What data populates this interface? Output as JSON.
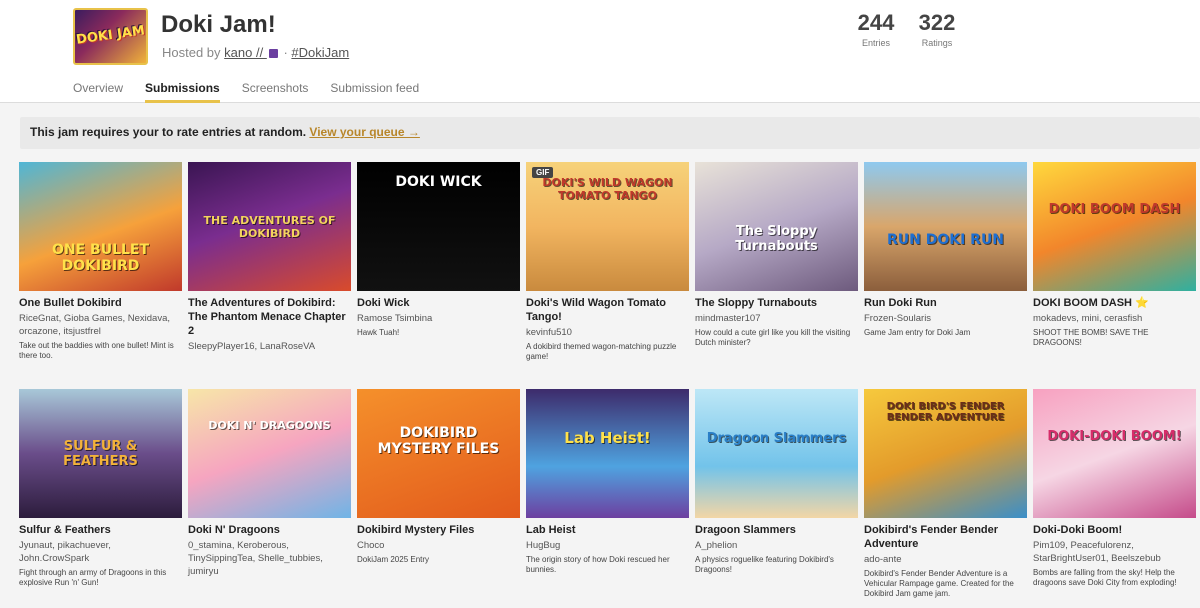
{
  "jam": {
    "title": "Doki Jam!",
    "logo_text": "DOKI JAM",
    "hosted_prefix": "Hosted by",
    "host": "kano // ",
    "host_icon": "floppy-disk-icon",
    "hashtag": "#DokiJam",
    "stats": [
      {
        "value": "244",
        "label": "Entries"
      },
      {
        "value": "322",
        "label": "Ratings"
      }
    ]
  },
  "tabs": [
    {
      "label": "Overview",
      "active": false
    },
    {
      "label": "Submissions",
      "active": true
    },
    {
      "label": "Screenshots",
      "active": false
    },
    {
      "label": "Submission feed",
      "active": false
    }
  ],
  "notice": {
    "text": "This jam requires your to rate entries at random.",
    "link": "View your queue →"
  },
  "games": [
    {
      "title": "One Bullet Dokibird",
      "authors": "RiceGnat, Gioba Games, Nexidava, orcazone, itsjustfrel",
      "desc": "Take out the baddies with one bullet! Mint is there too.",
      "cover_text": "ONE BULLET DOKIBIRD",
      "gif": false
    },
    {
      "title": "The Adventures of Dokibird: The Phantom Menace Chapter 2",
      "authors": "SleepyPlayer16, LanaRoseVA",
      "desc": "",
      "cover_text": "THE ADVENTURES OF DOKIBIRD",
      "gif": false
    },
    {
      "title": "Doki Wick",
      "authors": "Ramose Tsimbina",
      "desc": "Hawk Tuah!",
      "cover_text": "DOKI WICK",
      "gif": false
    },
    {
      "title": "Doki's Wild Wagon Tomato Tango!",
      "authors": "kevinfu510",
      "desc": "A dokibird themed wagon-matching puzzle game!",
      "cover_text": "DOKI'S WILD WAGON TOMATO TANGO",
      "gif": true,
      "gif_label": "GIF"
    },
    {
      "title": "The Sloppy Turnabouts",
      "authors": "mindmaster107",
      "desc": "How could a cute girl like you kill the visiting Dutch minister?",
      "cover_text": "The Sloppy Turnabouts",
      "gif": false
    },
    {
      "title": "Run Doki Run",
      "authors": "Frozen-Soularis",
      "desc": "Game Jam entry for Doki Jam",
      "cover_text": "RUN DOKI RUN",
      "gif": false
    },
    {
      "title": "DOKI BOOM DASH ⭐",
      "authors": "mokadevs, mini, cerasfish",
      "desc": "SHOOT THE BOMB! SAVE THE DRAGOONS!",
      "cover_text": "DOKI BOOM DASH",
      "gif": false
    },
    {
      "title": "Sulfur & Feathers",
      "authors": "Jyunaut, pikachuever, John.CrowSpark",
      "desc": "Fight through an army of Dragoons in this explosive Run 'n' Gun!",
      "cover_text": "SULFUR & FEATHERS",
      "gif": false
    },
    {
      "title": "Doki N' Dragoons",
      "authors": "0_stamina, Keroberous, TinySippingTea, Shelle_tubbies, jumiryu",
      "desc": "",
      "cover_text": "DOKI N' DRAGOONS",
      "gif": false
    },
    {
      "title": "Dokibird Mystery Files",
      "authors": "Choco",
      "desc": "DokiJam 2025 Entry",
      "cover_text": "DOKIBIRD MYSTERY FILES",
      "gif": false
    },
    {
      "title": "Lab Heist",
      "authors": "HugBug",
      "desc": "The origin story of how Doki rescued her bunnies.",
      "cover_text": "Lab Heist!",
      "gif": false
    },
    {
      "title": "Dragoon Slammers",
      "authors": "A_phelion",
      "desc": "A physics roguelike featuring Dokibird's Dragoons!",
      "cover_text": "Dragoon Slammers",
      "gif": false
    },
    {
      "title": "Dokibird's Fender Bender Adventure",
      "authors": "ado-ante",
      "desc": "Dokibird's Fender Bender Adventure is a Vehicular Rampage game. Created for the Dokibird Jam game jam.",
      "cover_text": "DOKI BIRD'S FENDER BENDER ADVENTURE",
      "gif": false
    },
    {
      "title": "Doki-Doki Boom!",
      "authors": "Pim109, Peacefulorenz, StarBrightUser01, Beelszebub",
      "desc": "Bombs are falling from the sky! Help the dragoons save Doki City from exploding!",
      "cover_text": "DOKI-DOKI BOOM!",
      "gif": false
    }
  ],
  "colors": {
    "accent": "#e8c24a",
    "link": "#b8862a"
  }
}
